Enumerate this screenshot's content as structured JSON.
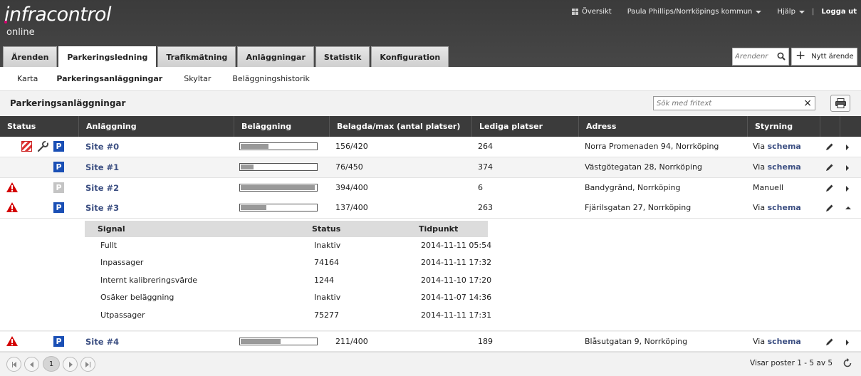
{
  "header": {
    "logo_text": "infracontrol",
    "logo_sub": "online",
    "overview": "Översikt",
    "user": "Paula Phillips/Norrköpings kommun",
    "help": "Hjälp",
    "logout": "Logga ut"
  },
  "tabs": [
    {
      "label": "Ärenden"
    },
    {
      "label": "Parkeringsledning"
    },
    {
      "label": "Trafikmätning"
    },
    {
      "label": "Anläggningar"
    },
    {
      "label": "Statistik"
    },
    {
      "label": "Konfiguration"
    }
  ],
  "case_search": {
    "placeholder": "Ärendenr"
  },
  "new_case": {
    "label": "Nytt ärende"
  },
  "subnav": [
    {
      "label": "Karta"
    },
    {
      "label": "Parkeringsanläggningar"
    },
    {
      "label": "Skyltar"
    },
    {
      "label": "Beläggningshistorik"
    }
  ],
  "panel": {
    "title": "Parkeringsanläggningar",
    "search_placeholder": "Sök med fritext"
  },
  "columns": {
    "status": "Status",
    "facility": "Anläggning",
    "occupancy": "Beläggning",
    "occupied_max": "Belagda/max (antal platser)",
    "free": "Lediga platser",
    "address": "Adress",
    "control": "Styrning"
  },
  "rows": [
    {
      "site": "Site #0",
      "occ": 0.37,
      "occupied": "156/420",
      "free": "264",
      "address": "Norra Promenaden 94, Norrköping",
      "control_prefix": "Via",
      "control_link": "schema"
    },
    {
      "site": "Site #1",
      "occ": 0.17,
      "occupied": "76/450",
      "free": "374",
      "address": "Västgötegatan 28, Norrköping",
      "control_prefix": "Via",
      "control_link": "schema"
    },
    {
      "site": "Site #2",
      "occ": 0.985,
      "occupied": "394/400",
      "free": "6",
      "address": "Bandygränd, Norrköping",
      "control_prefix": "Manuell",
      "control_link": ""
    },
    {
      "site": "Site #3",
      "occ": 0.34,
      "occupied": "137/400",
      "free": "263",
      "address": "Fjärilsgatan 27, Norrköping",
      "control_prefix": "Via",
      "control_link": "schema"
    },
    {
      "site": "Site #4",
      "occ": 0.53,
      "occupied": "211/400",
      "free": "189",
      "address": "Blåsutgatan 9, Norrköping",
      "control_prefix": "Via",
      "control_link": "schema"
    }
  ],
  "detail": {
    "headers": {
      "signal": "Signal",
      "status": "Status",
      "time": "Tidpunkt"
    },
    "rows": [
      {
        "signal": "Fullt",
        "status": "Inaktiv",
        "time": "2014-11-11 05:54"
      },
      {
        "signal": "Inpassager",
        "status": "74164",
        "time": "2014-11-11 17:32"
      },
      {
        "signal": "Internt kalibreringsvärde",
        "status": "1244",
        "time": "2014-11-10 17:20"
      },
      {
        "signal": "Osäker beläggning",
        "status": "Inaktiv",
        "time": "2014-11-07 14:36"
      },
      {
        "signal": "Utpassager",
        "status": "75277",
        "time": "2014-11-11 17:31"
      }
    ]
  },
  "pager": {
    "current_page": "1",
    "showing": "Visar poster 1 - 5 av 5"
  },
  "colors": {
    "link": "#3c4f82",
    "parking_badge": "#1a4fb5",
    "warning": "#d40000"
  }
}
